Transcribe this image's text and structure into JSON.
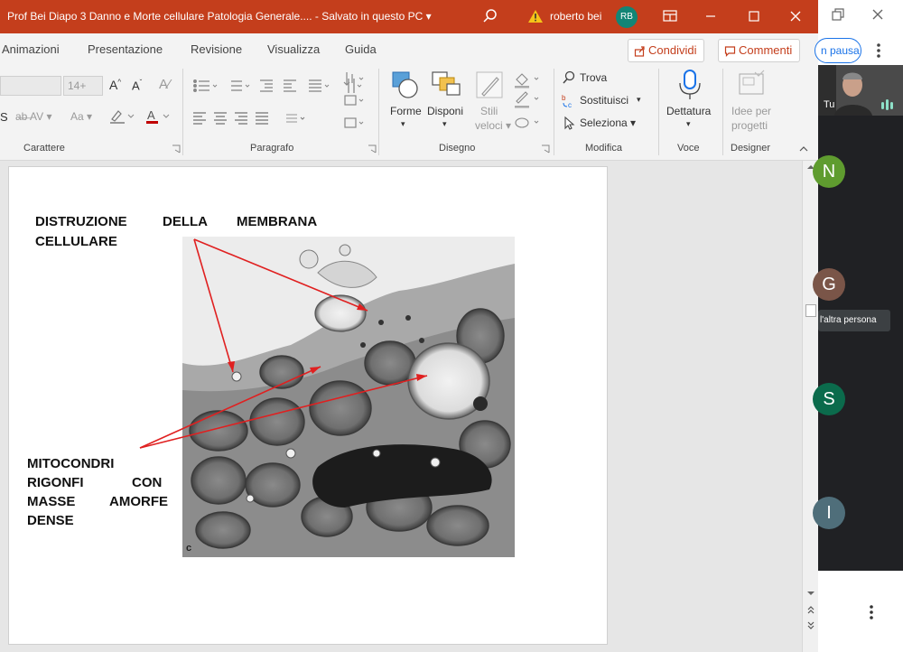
{
  "window": {
    "title": "Prof Bei  Diapo 3 Danno e Morte cellulare  Patologia Generale....  -  Salvato in questo PC ▾",
    "user_name": "roberto bei",
    "user_initials": "RB"
  },
  "tabs": [
    "Animazioni",
    "Presentazione",
    "Revisione",
    "Visualizza",
    "Guida"
  ],
  "share_button": "Condividi",
  "comments_button": "Commenti",
  "ribbon": {
    "font_size": "14+",
    "groups": {
      "carattere": "Carattere",
      "paragrafo": "Paragrafo",
      "disegno": "Disegno",
      "modifica": "Modifica",
      "voce": "Voce",
      "designer": "Designer"
    },
    "drawing": {
      "forme": "Forme",
      "disponi": "Disponi",
      "stili_line1": "Stili",
      "stili_line2": "veloci ▾"
    },
    "editing": {
      "trova": "Trova",
      "sostituisci": "Sostituisci",
      "seleziona": "Seleziona ▾"
    },
    "voice": {
      "dettatura": "Dettatura"
    },
    "designer": {
      "line1": "Idee per",
      "line2": "progetti"
    }
  },
  "slide": {
    "label_top_line1": [
      "DISTRUZIONE",
      "DELLA",
      "MEMBRANA"
    ],
    "label_top_line2": "CELLULARE",
    "label_bottom": [
      [
        "MITOCONDRI"
      ],
      [
        "RIGONFI",
        "CON"
      ],
      [
        "MASSE",
        "AMORFE"
      ],
      [
        "DENSE"
      ]
    ],
    "micrograph_corner_letter": "c"
  },
  "meet": {
    "pause_label": "n pausa",
    "self_label": "Tu",
    "participants": [
      {
        "initial": "N",
        "color": "#5f9c2f"
      },
      {
        "initial": "G",
        "color": "#7a5548"
      },
      {
        "initial": "S",
        "color": "#0b6b4c"
      },
      {
        "initial": "I",
        "color": "#4f6e7a"
      }
    ],
    "tooltip": "l'altra persona"
  }
}
